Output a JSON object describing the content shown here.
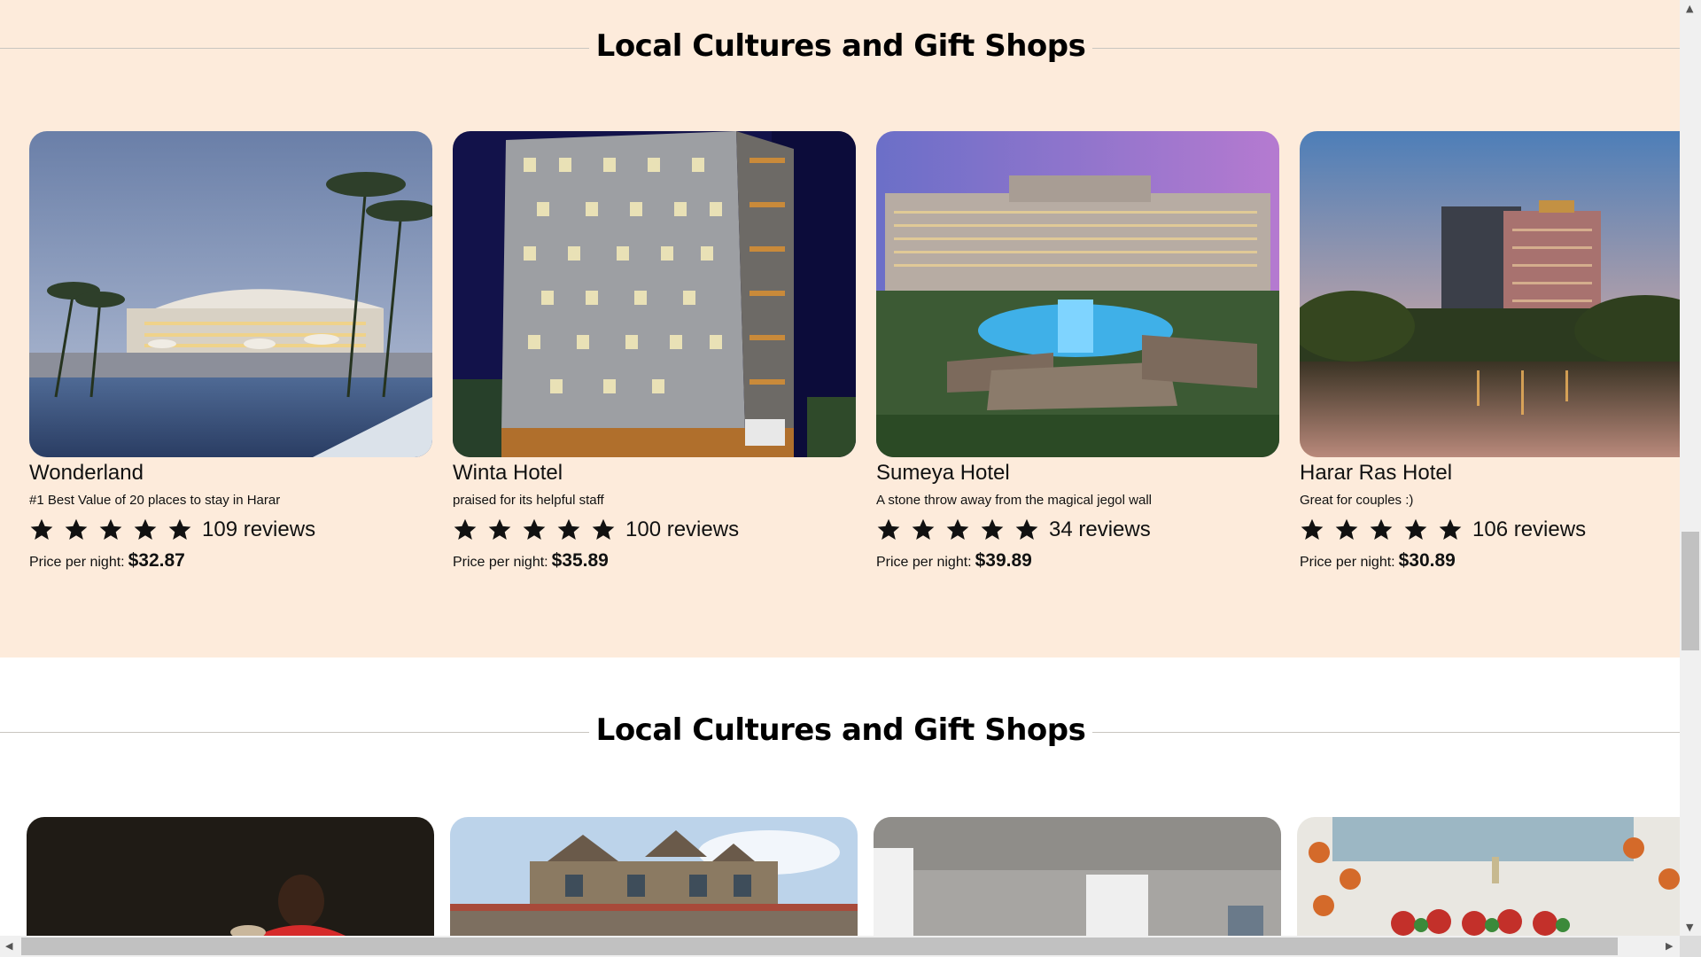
{
  "sections": [
    {
      "title": "Local Cultures and Gift Shops",
      "hotels": [
        {
          "name": "Wonderland",
          "tagline": "#1 Best Value of 20 places to stay in Harar",
          "rating": 5,
          "reviews": "109 reviews",
          "price_label": "Price per night:",
          "price": "$32.87",
          "image": "resort-pool-palms"
        },
        {
          "name": "Winta Hotel",
          "tagline": "praised for its helpful staff",
          "rating": 5,
          "reviews": "100 reviews",
          "price_label": "Price per night:",
          "price": "$35.89",
          "image": "tower-night"
        },
        {
          "name": "Sumeya Hotel",
          "tagline": "A stone throw away from the magical jegol wall",
          "rating": 5,
          "reviews": "34 reviews",
          "price_label": "Price per night:",
          "price": "$39.89",
          "image": "palace-resort-pool"
        },
        {
          "name": "Harar Ras Hotel",
          "tagline": "Great for couples :)",
          "rating": 5,
          "reviews": "106 reviews",
          "price_label": "Price per night:",
          "price": "$30.89",
          "image": "lakeside-tower-sunset"
        }
      ]
    },
    {
      "title": "Local Cultures and Gift Shops",
      "shops": [
        {
          "image": "man-night-portrait"
        },
        {
          "image": "historic-wooden-house"
        },
        {
          "image": "white-interior-columns"
        },
        {
          "image": "decorated-room-baskets"
        }
      ]
    }
  ],
  "colors": {
    "section_bg": "#fdebdb",
    "star": "#111111"
  },
  "icons": {
    "star": "star-icon"
  },
  "scrollbars": {
    "vertical_up": "▲",
    "vertical_down": "▼",
    "horizontal_left": "◀",
    "horizontal_right": "▶"
  }
}
